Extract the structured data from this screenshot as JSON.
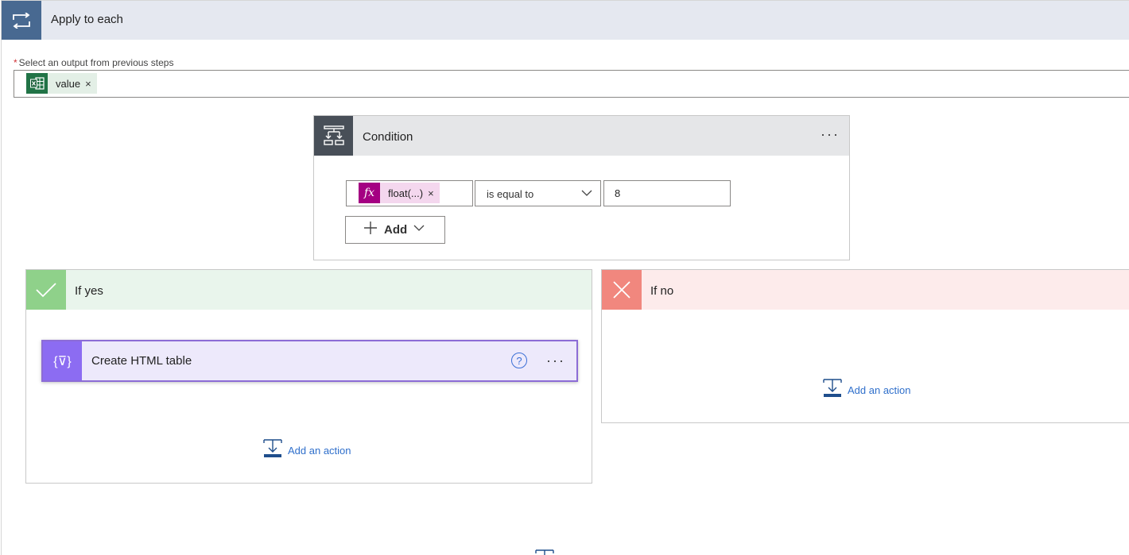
{
  "apply_to_each": {
    "title": "Apply to each",
    "icon": "loop-icon",
    "select_label": "Select an output from previous steps",
    "required_marker": "*",
    "token": {
      "label": "value",
      "remove": "×",
      "icon": "excel-icon"
    }
  },
  "condition": {
    "title": "Condition",
    "icon": "condition-icon",
    "more": "···",
    "left_token": {
      "label": "float(...)",
      "remove": "×",
      "icon_text": "fx"
    },
    "operator": "is equal to",
    "value": "8",
    "add_label": "Add"
  },
  "if_yes": {
    "title": "If yes",
    "action": {
      "title": "Create HTML table",
      "help": "?",
      "more": "···",
      "icon_text": "{⊽}"
    },
    "add_action": "Add an action"
  },
  "if_no": {
    "title": "If no",
    "add_action": "Add an action"
  },
  "colors": {
    "apply_each_accent": "#486991",
    "condition_accent": "#484f58",
    "yes_accent": "#8fd18a",
    "no_accent": "#f1877e",
    "html_table_accent": "#8c6cf2",
    "link": "#2f6fcb"
  }
}
